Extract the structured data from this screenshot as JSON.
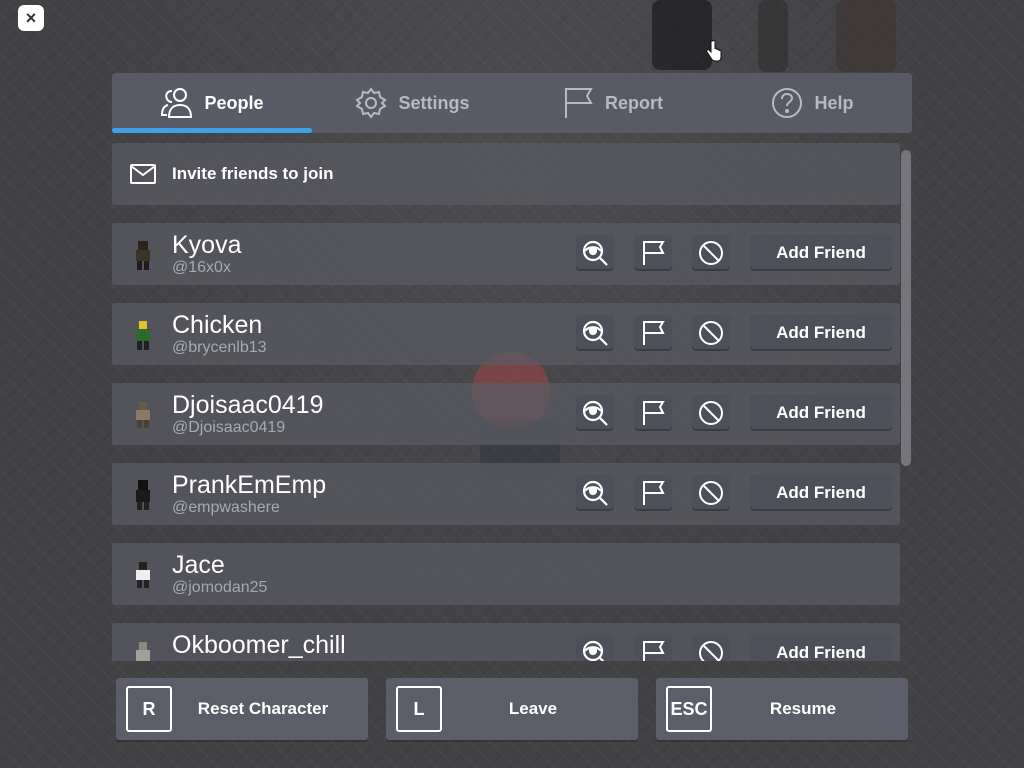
{
  "window": {
    "close_label": "×"
  },
  "tabs": [
    {
      "label": "People",
      "icon": "people-icon",
      "active": true
    },
    {
      "label": "Settings",
      "icon": "gear-icon",
      "active": false
    },
    {
      "label": "Report",
      "icon": "flag-icon",
      "active": false
    },
    {
      "label": "Help",
      "icon": "help-icon",
      "active": false
    }
  ],
  "invite": {
    "label": "Invite friends to join",
    "icon": "mail-icon"
  },
  "players": [
    {
      "name": "Kyova",
      "username": "@16x0x",
      "add_label": "Add Friend",
      "has_actions": true
    },
    {
      "name": "Chicken",
      "username": "@brycenlb13",
      "add_label": "Add Friend",
      "has_actions": true
    },
    {
      "name": "Djoisaac0419",
      "username": "@Djoisaac0419",
      "add_label": "Add Friend",
      "has_actions": true
    },
    {
      "name": "PrankEmEmp",
      "username": "@empwashere",
      "add_label": "Add Friend",
      "has_actions": true
    },
    {
      "name": "Jace",
      "username": "@jomodan25",
      "add_label": "",
      "has_actions": false
    },
    {
      "name": "Okboomer_chill",
      "username": "",
      "add_label": "Add Friend",
      "has_actions": true
    }
  ],
  "bottom": {
    "reset": {
      "key": "R",
      "label": "Reset Character"
    },
    "leave": {
      "key": "L",
      "label": "Leave"
    },
    "resume": {
      "key": "ESC",
      "label": "Resume"
    }
  },
  "colors": {
    "accent": "#3ea2e8",
    "panel": "#5a5c68",
    "button": "#4d5058"
  }
}
